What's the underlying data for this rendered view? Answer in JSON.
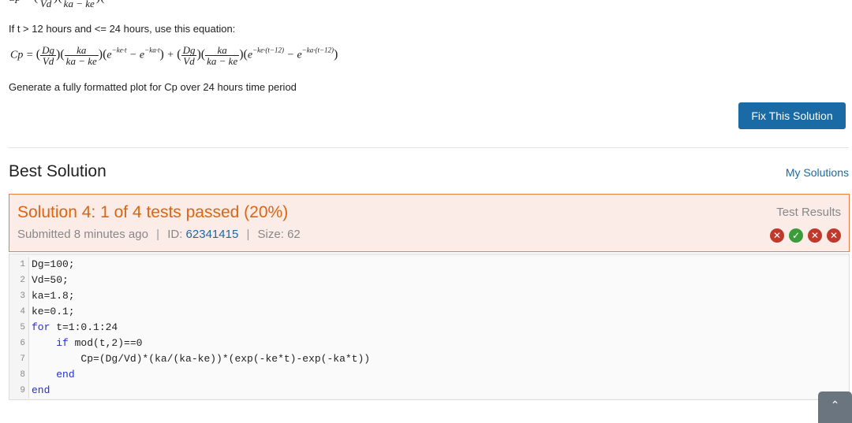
{
  "problem": {
    "partial_top": "Cp = (Dg/Vd)(ka/(ka − ke))(",
    "condition_text": "If t > 12 hours and <= 24 hours, use this equation:",
    "equation": {
      "lhs": "Cp",
      "dg": "Dg",
      "vd": "Vd",
      "ka": "ka",
      "ka_minus_ke": "ka − ke",
      "exp1": "e",
      "exp1_sup": "−ke·t",
      "exp2_sup": "−ka·t",
      "exp3_sup": "−ke·(t−12)",
      "exp4_sup": "−ka·(t−12)"
    },
    "instruction": "Generate a fully formatted plot for Cp over 24 hours time period",
    "fix_button": "Fix This Solution"
  },
  "best": {
    "heading": "Best Solution",
    "my_solutions": "My Solutions",
    "title": "Solution 4: 1 of 4 tests passed (20%)",
    "submitted_label": "Submitted",
    "submitted_value": "8 minutes ago",
    "id_label": "ID:",
    "id_value": "62341415",
    "size_label": "Size:",
    "size_value": "62",
    "test_results_label": "Test Results",
    "tests": [
      "fail",
      "pass",
      "fail",
      "fail"
    ]
  },
  "code": [
    {
      "n": "1",
      "text": "Dg=100;"
    },
    {
      "n": "2",
      "text": "Vd=50;"
    },
    {
      "n": "3",
      "text": "ka=1.8;"
    },
    {
      "n": "4",
      "text": "ke=0.1;"
    },
    {
      "n": "5",
      "kw": "for",
      "text": " t=1:0.1:24"
    },
    {
      "n": "6",
      "indent": "    ",
      "kw": "if",
      "text": " mod(t,2)==0"
    },
    {
      "n": "7",
      "indent": "        ",
      "text": "Cp=(Dg/Vd)*(ka/(ka-ke))*(exp(-ke*t)-exp(-ka*t))"
    },
    {
      "n": "8",
      "indent": "    ",
      "kw": "end",
      "text": ""
    },
    {
      "n": "9",
      "kw": "end",
      "text": ""
    }
  ],
  "scroll_top_icon": "chevron-up-icon"
}
